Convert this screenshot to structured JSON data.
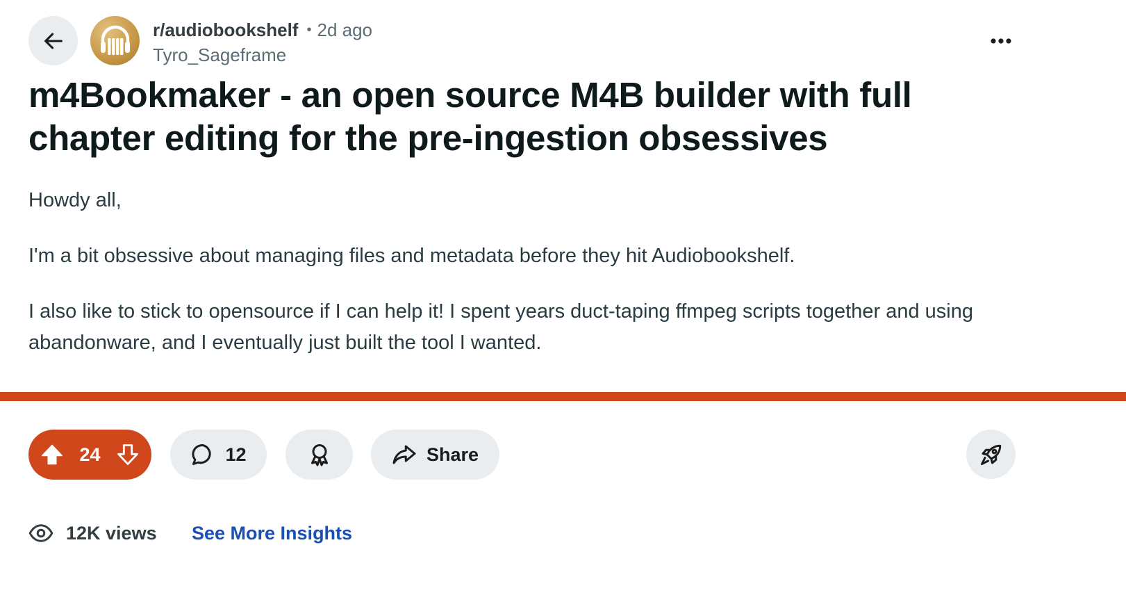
{
  "header": {
    "subreddit": "r/audiobookshelf",
    "separator": "•",
    "timestamp": "2d ago",
    "author": "Tyro_Sageframe"
  },
  "post": {
    "title": "m4Bookmaker - an open source M4B builder with full chapter editing for the pre-ingestion obsessives",
    "paragraphs": [
      "Howdy all,",
      "I'm a bit obsessive about managing files and metadata before they hit Audiobookshelf.",
      "I also like to stick to opensource if I can help it! I spent years duct-taping ffmpeg scripts together and using abandonware, and I eventually just built the tool I wanted."
    ]
  },
  "actions": {
    "vote_count": "24",
    "comment_count": "12",
    "share_label": "Share"
  },
  "footer": {
    "views": "12K views",
    "insights_label": "See More Insights"
  },
  "colors": {
    "accent": "#d0471c",
    "pill_bg": "#eaedef",
    "link": "#1a4fb4"
  },
  "icons": [
    "back-arrow-icon",
    "more-options-icon",
    "upvote-icon",
    "downvote-icon",
    "comment-icon",
    "award-icon",
    "share-icon",
    "boost-icon",
    "eye-icon"
  ]
}
